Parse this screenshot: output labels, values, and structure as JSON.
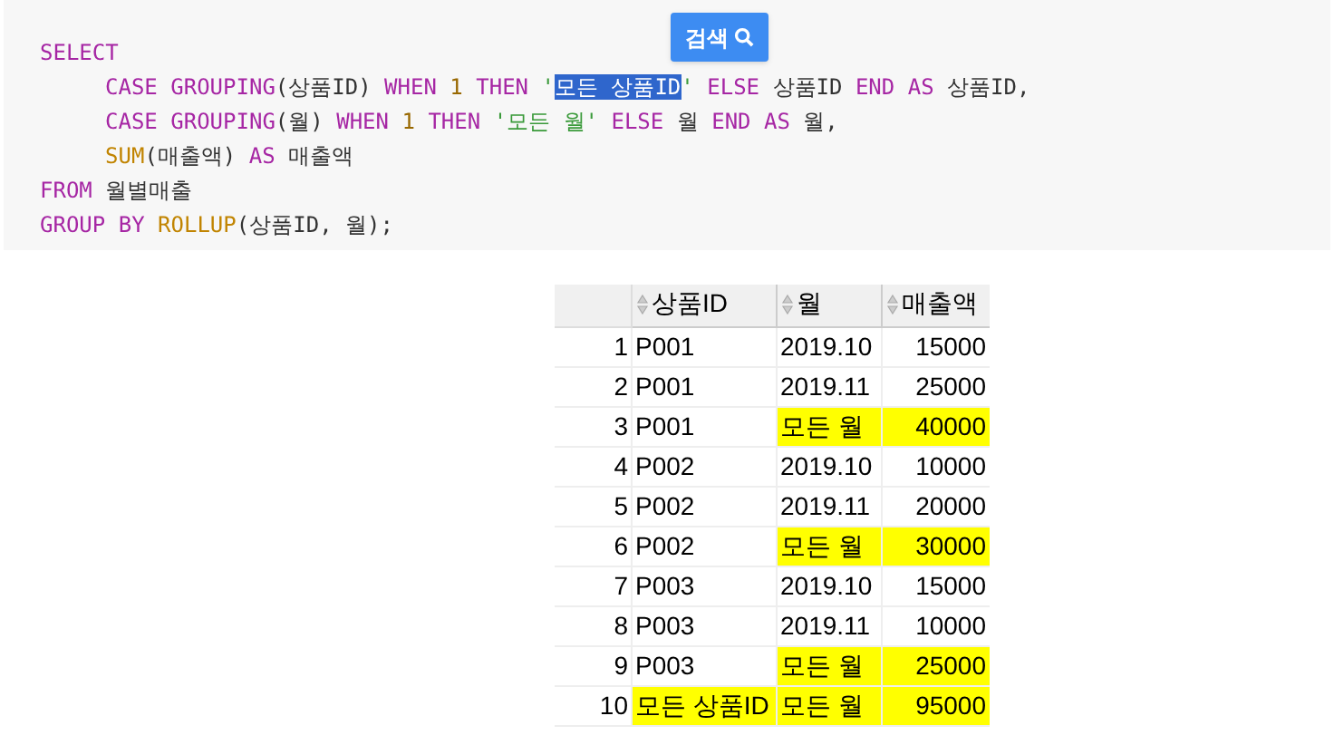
{
  "search_button": {
    "label": "검색"
  },
  "code": [
    [
      {
        "kind": "keyword",
        "text": "SELECT"
      }
    ],
    [
      {
        "kind": "keyword",
        "text": "CASE GROUPING"
      },
      {
        "kind": "plain",
        "text": "(상품ID) "
      },
      {
        "kind": "keyword",
        "text": "WHEN "
      },
      {
        "kind": "number",
        "text": "1 "
      },
      {
        "kind": "keyword",
        "text": "THEN "
      },
      {
        "kind": "string",
        "text": "'"
      },
      {
        "kind": "selection",
        "text": "모든 상품ID"
      },
      {
        "kind": "string",
        "text": "'"
      },
      {
        "kind": "keyword",
        "text": " ELSE "
      },
      {
        "kind": "plain",
        "text": "상품ID "
      },
      {
        "kind": "keyword",
        "text": "END AS "
      },
      {
        "kind": "plain",
        "text": "상품ID,"
      }
    ],
    [
      {
        "kind": "keyword",
        "text": "CASE GROUPING"
      },
      {
        "kind": "plain",
        "text": "(월) "
      },
      {
        "kind": "keyword",
        "text": "WHEN "
      },
      {
        "kind": "number",
        "text": "1 "
      },
      {
        "kind": "keyword",
        "text": "THEN "
      },
      {
        "kind": "string",
        "text": "'모든 월'"
      },
      {
        "kind": "keyword",
        "text": " ELSE "
      },
      {
        "kind": "plain",
        "text": "월 "
      },
      {
        "kind": "keyword",
        "text": "END AS "
      },
      {
        "kind": "plain",
        "text": "월,"
      }
    ],
    [
      {
        "kind": "function",
        "text": "SUM"
      },
      {
        "kind": "plain",
        "text": "(매출액) "
      },
      {
        "kind": "keyword",
        "text": "AS "
      },
      {
        "kind": "plain",
        "text": "매출액"
      }
    ],
    [
      {
        "kind": "keyword",
        "text": "FROM "
      },
      {
        "kind": "plain",
        "text": "월별매출"
      }
    ],
    [
      {
        "kind": "keyword",
        "text": "GROUP BY "
      },
      {
        "kind": "function",
        "text": "ROLLUP"
      },
      {
        "kind": "plain",
        "text": "(상품ID, 월);"
      }
    ]
  ],
  "table": {
    "columns": [
      "상품ID",
      "월",
      "매출액"
    ],
    "rows": [
      {
        "number": "1",
        "cells": [
          {
            "text": "P001",
            "highlighted": false
          },
          {
            "text": "2019.10",
            "highlighted": false
          },
          {
            "text": "15000",
            "highlighted": false
          }
        ]
      },
      {
        "number": "2",
        "cells": [
          {
            "text": "P001",
            "highlighted": false
          },
          {
            "text": "2019.11",
            "highlighted": false
          },
          {
            "text": "25000",
            "highlighted": false
          }
        ]
      },
      {
        "number": "3",
        "cells": [
          {
            "text": "P001",
            "highlighted": false
          },
          {
            "text": "모든 월",
            "highlighted": true
          },
          {
            "text": "40000",
            "highlighted": true
          }
        ]
      },
      {
        "number": "4",
        "cells": [
          {
            "text": "P002",
            "highlighted": false
          },
          {
            "text": "2019.10",
            "highlighted": false
          },
          {
            "text": "10000",
            "highlighted": false
          }
        ]
      },
      {
        "number": "5",
        "cells": [
          {
            "text": "P002",
            "highlighted": false
          },
          {
            "text": "2019.11",
            "highlighted": false
          },
          {
            "text": "20000",
            "highlighted": false
          }
        ]
      },
      {
        "number": "6",
        "cells": [
          {
            "text": "P002",
            "highlighted": false
          },
          {
            "text": "모든 월",
            "highlighted": true
          },
          {
            "text": "30000",
            "highlighted": true
          }
        ]
      },
      {
        "number": "7",
        "cells": [
          {
            "text": "P003",
            "highlighted": false
          },
          {
            "text": "2019.10",
            "highlighted": false
          },
          {
            "text": "15000",
            "highlighted": false
          }
        ]
      },
      {
        "number": "8",
        "cells": [
          {
            "text": "P003",
            "highlighted": false
          },
          {
            "text": "2019.11",
            "highlighted": false
          },
          {
            "text": "10000",
            "highlighted": false
          }
        ]
      },
      {
        "number": "9",
        "cells": [
          {
            "text": "P003",
            "highlighted": false
          },
          {
            "text": "모든 월",
            "highlighted": true
          },
          {
            "text": "25000",
            "highlighted": true
          }
        ]
      },
      {
        "number": "10",
        "cells": [
          {
            "text": "모든 상품ID",
            "highlighted": true
          },
          {
            "text": "모든 월",
            "highlighted": true
          },
          {
            "text": "95000",
            "highlighted": true
          }
        ]
      }
    ]
  }
}
